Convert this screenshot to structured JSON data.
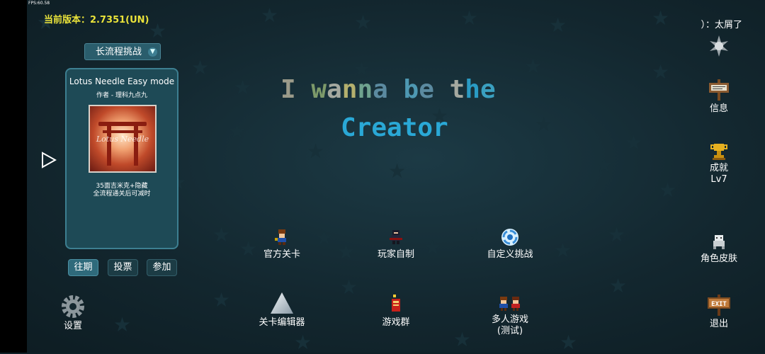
{
  "fps": "FPS:60.58",
  "version": "当前版本：2.7351(UN)",
  "top_right": "）：太屑了",
  "mode_select": "长流程挑战",
  "level_card": {
    "title": "Lotus Needle Easy mode",
    "author": "作者 - 理科九点九",
    "thumb_text": "Lotus Needle",
    "desc_line1": "35面吉米克+隐藏",
    "desc_line2": "全流程通关后可减时"
  },
  "tabs": [
    "往期",
    "投票",
    "参加"
  ],
  "game_title": {
    "line1": "I wanna be the",
    "line2": "Creator"
  },
  "title_colors": [
    "#9b9b8a",
    "#7d9a6a",
    "#a5a9a0",
    "#b4b06e",
    "#6fa38f",
    "#5b8aa0",
    "#4e98b2",
    "#5b8aa0",
    "#a5a9a0",
    "#2a9bc4",
    "#3aa0c0",
    "#c3c08b",
    "#5aa9c0",
    "#3d9fcd"
  ],
  "creator_color": "#2aa8d6",
  "menu": {
    "official": "官方关卡",
    "player_made": "玩家自制",
    "custom_challenge": "自定义挑战",
    "level_editor": "关卡编辑器",
    "game_group": "游戏群",
    "multiplayer": "多人游戏",
    "multiplayer_sub": "(测试)"
  },
  "side": {
    "info": "信息",
    "achievements": "成就",
    "level": "Lv7",
    "skins": "角色皮肤",
    "exit": "退出",
    "exit_sign": "EXIT"
  },
  "settings": "设置",
  "colors": {
    "bg": "#13272f",
    "accent": "#2f6a7b",
    "version": "#e9e23a"
  }
}
